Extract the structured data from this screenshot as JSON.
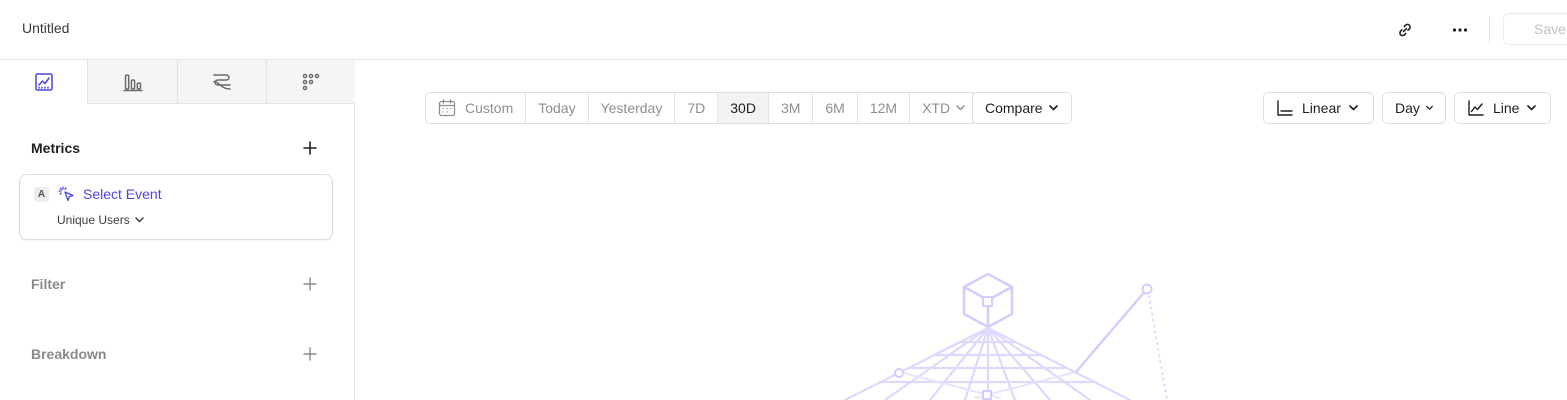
{
  "header": {
    "title": "Untitled",
    "save_label": "Save",
    "link_icon": "link-icon",
    "more_icon": "more-horizontal-icon"
  },
  "sidebar": {
    "tabs": [
      {
        "icon": "insights-line-chart-icon",
        "active": true
      },
      {
        "icon": "funnel-bars-icon",
        "active": false
      },
      {
        "icon": "flows-icon",
        "active": false
      },
      {
        "icon": "retention-grid-icon",
        "active": false
      }
    ],
    "metrics": {
      "title": "Metrics",
      "letter": "A",
      "select_event": "Select Event",
      "aggregation": "Unique Users"
    },
    "filter": {
      "title": "Filter"
    },
    "breakdown": {
      "title": "Breakdown"
    }
  },
  "toolbar": {
    "date_ranges": [
      "Custom",
      "Today",
      "Yesterday",
      "7D",
      "30D",
      "3M",
      "6M",
      "12M",
      "XTD"
    ],
    "active_range": "30D",
    "compare": "Compare",
    "scale": "Linear",
    "interval": "Day",
    "chart_type": "Line"
  },
  "colors": {
    "accent": "#4f44e0",
    "illustration": "#d9d6fb",
    "border": "#dedede"
  }
}
